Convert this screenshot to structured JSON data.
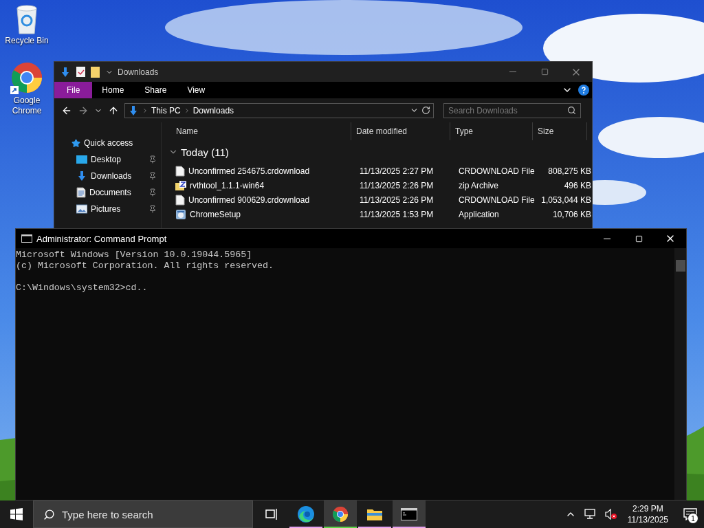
{
  "desktop_icons": [
    {
      "kind": "recycle_bin",
      "label": "Recycle Bin"
    },
    {
      "kind": "chrome",
      "label": "Google Chrome"
    }
  ],
  "explorer": {
    "title": "Downloads",
    "ribbon_tabs": [
      {
        "label": "File",
        "kind": "file_menu"
      },
      {
        "label": "Home",
        "kind": "tab"
      },
      {
        "label": "Share",
        "kind": "tab"
      },
      {
        "label": "View",
        "kind": "tab"
      }
    ],
    "breadcrumbs": [
      "This PC",
      "Downloads"
    ],
    "search": {
      "placeholder": "Search Downloads"
    },
    "nav_pane": {
      "heading": "Quick access",
      "items": [
        {
          "label": "Desktop",
          "kind": "desktop",
          "pinned": true
        },
        {
          "label": "Downloads",
          "kind": "downloads",
          "pinned": true
        },
        {
          "label": "Documents",
          "kind": "documents",
          "pinned": true
        },
        {
          "label": "Pictures",
          "kind": "pictures",
          "pinned": true
        }
      ]
    },
    "columns": [
      "Name",
      "Date modified",
      "Type",
      "Size"
    ],
    "group": {
      "label": "Today (11)",
      "expanded": true
    },
    "rows": [
      {
        "kind": "file",
        "name": "Unconfirmed 254675.crdownload",
        "date": "11/13/2025 2:27 PM",
        "type": "CRDOWNLOAD File",
        "size": "808,275 KB"
      },
      {
        "kind": "zip",
        "name": "rvthtool_1.1.1-win64",
        "date": "11/13/2025 2:26 PM",
        "type": "zip Archive",
        "size": "496 KB"
      },
      {
        "kind": "file",
        "name": "Unconfirmed 900629.crdownload",
        "date": "11/13/2025 2:26 PM",
        "type": "CRDOWNLOAD File",
        "size": "1,053,044 KB"
      },
      {
        "kind": "setup",
        "name": "ChromeSetup",
        "date": "11/13/2025 1:53 PM",
        "type": "Application",
        "size": "10,706 KB"
      }
    ]
  },
  "console": {
    "title": "Administrator: Command Prompt",
    "lines": [
      "Microsoft Windows [Version 10.0.19044.5965]",
      "(c) Microsoft Corporation. All rights reserved."
    ],
    "prompt": "C:\\Windows\\system32>cd.."
  },
  "taskbar": {
    "search": {
      "placeholder": "Type here to search"
    },
    "apps": [
      {
        "kind": "task_view",
        "active": false
      },
      {
        "kind": "edge",
        "active": false,
        "color": "#e6a3f0"
      },
      {
        "kind": "chrome",
        "active": true,
        "color": "#5fd34a"
      },
      {
        "kind": "explorer",
        "active": false,
        "color": "#e6a3f0"
      },
      {
        "kind": "console",
        "active": true,
        "color": "#e6a3f0"
      }
    ],
    "volume_muted": true,
    "time": "2:29 PM",
    "date": "11/13/2025",
    "notifications": "1"
  }
}
